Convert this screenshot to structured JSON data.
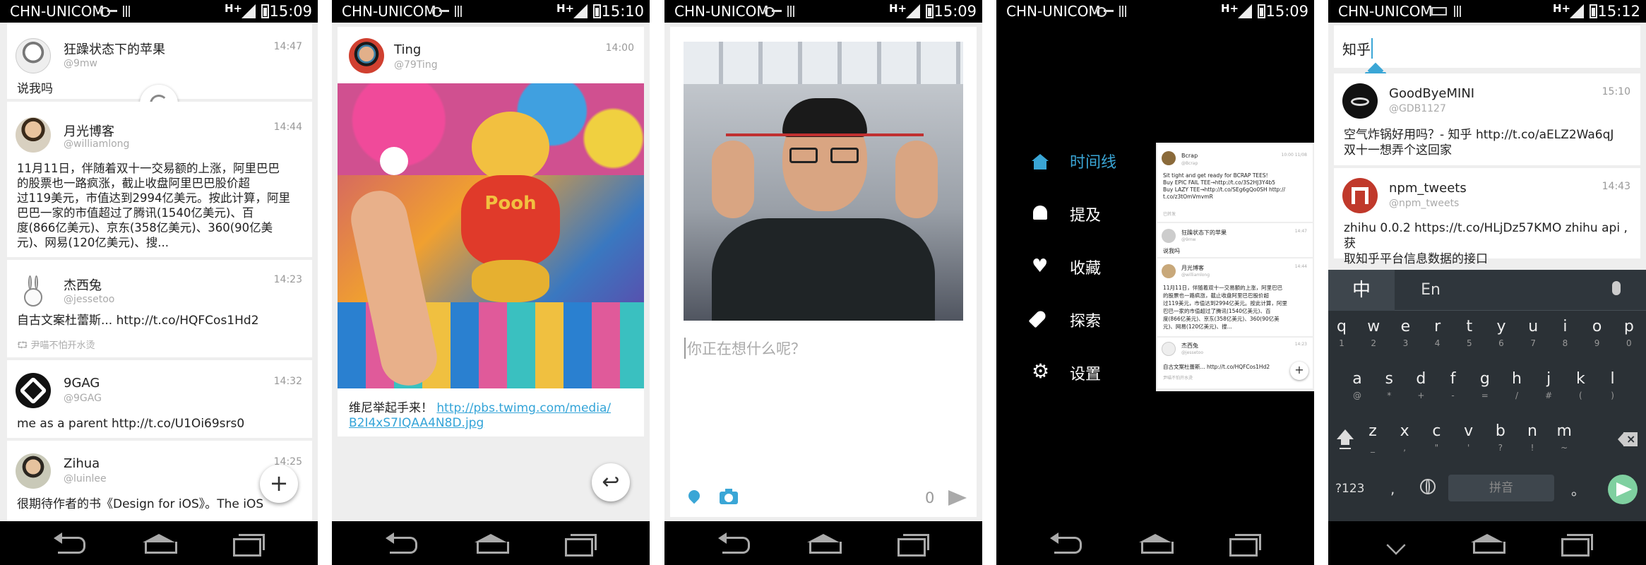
{
  "status": {
    "carrier": "CHN-UNICOM",
    "network": "H+",
    "times": [
      "15:09",
      "15:10",
      "15:09",
      "15:09",
      "15:12"
    ]
  },
  "timeline": {
    "tweets": [
      {
        "name": "狂躁状态下的苹果",
        "handle": "@9mw",
        "time": "14:47",
        "text": "说我吗"
      },
      {
        "name": "月光博客",
        "handle": "@williamlong",
        "time": "14:44",
        "lines": [
          "11月11日，伴随着双十一交易额的上涨，阿里巴巴",
          "的股票也一路疯涨，截止收盘阿里巴巴股价超",
          "过119美元，市值达到2994亿美元。按此计算，阿里",
          "巴巴一家的市值超过了腾讯(1540亿美元)、百",
          "度(866亿美元)、京东(358亿美元)、360(90亿美",
          "元)、网易(120亿美元)、搜..."
        ]
      },
      {
        "name": "杰西兔",
        "handle": "@jessetoo",
        "time": "14:23",
        "text": "自古文案杜蕾斯... http://t.co/HQFCos1Hd2",
        "retweet": "尹喵不怕开水烫"
      },
      {
        "name": "9GAG",
        "handle": "@9GAG",
        "time": "14:32",
        "text": "me as a parent http://t.co/U1Oi69srs0"
      },
      {
        "name": "Zihua",
        "handle": "@luinlee",
        "time": "14:25",
        "text": "很期待作者的书《Design for iOS》。The iOS"
      }
    ],
    "fab": "+"
  },
  "detail": {
    "name": "Ting",
    "handle": "@79Ting",
    "time": "14:00",
    "text": "维尼举起手来！",
    "link1": "http://pbs.twimg.com/media/",
    "link2": "B2I4xS7IQAA4N8D.jpg",
    "reply": "↩"
  },
  "compose": {
    "placeholder": "你正在想什么呢？",
    "count": "0"
  },
  "drawer": {
    "items": [
      {
        "label": "时间线",
        "icon": "home-icon",
        "active": true
      },
      {
        "label": "提及",
        "icon": "bell-icon"
      },
      {
        "label": "收藏",
        "icon": "heart-icon"
      },
      {
        "label": "探索",
        "icon": "rocket-icon"
      },
      {
        "label": "设置",
        "icon": "gear-icon"
      }
    ],
    "mini": {
      "t1name": "Bcrap",
      "t1handle": "@Bcrap",
      "t1time": "10:00 11/08",
      "t1lines": [
        "Sit tight and get ready for BCRAP TEES!",
        "Buy EPIC FAIL TEE→http://t.co/3S2HJ3Y4b5",
        "Buy LAZY TEE→http://t.co/SEg6gQo0SH http://",
        "t.co/z3tOmVmvmR"
      ],
      "t1rt": "已转发",
      "t2name": "狂躁状态下的苹果",
      "t2handle": "@9mw",
      "t2time": "14:47",
      "t2text": "说我吗",
      "t3name": "月光博客",
      "t3handle": "@williamlong",
      "t3time": "14:44",
      "t3lines": [
        "11月11日，伴随着双十一交易额的上涨，阿里巴巴",
        "的股票也一路疯涨，截止收盘阿里巴巴股价超",
        "过119美元，市值达到2994亿美元。按此计算，阿里",
        "巴巴一家的市值超过了腾讯(1540亿美元)、百",
        "度(866亿美元)、京东(358亿美元)、360(90亿美",
        "元)、网易(120亿美元)、搜..."
      ],
      "t4name": "杰西兔",
      "t4handle": "@jessetoo",
      "t4time": "14:23",
      "t4text": "自古文案杜蕾斯... http://t.co/HQFCos1Hd2",
      "t4rt": "尹喵不怕开水烫"
    }
  },
  "search": {
    "query": "知乎",
    "results": [
      {
        "name": "GoodByeMINI",
        "handle": "@GDB1127",
        "time": "15:10",
        "lines": [
          "空气炸锅好用吗？- 知乎 http://t.co/aELZ2Wa6qJ",
          "双十一想弄个这回家"
        ]
      },
      {
        "name": "npm_tweets",
        "handle": "@npm_tweets",
        "time": "14:43",
        "lines": [
          "zhihu 0.0.2 https://t.co/HLjDz57KMO zhihu api ,获",
          "取知乎平台信息数据的接口"
        ]
      }
    ]
  },
  "keyboard": {
    "lang_cn": "中",
    "lang_en": "En",
    "row1": [
      "q",
      "w",
      "e",
      "r",
      "t",
      "y",
      "u",
      "i",
      "o",
      "p"
    ],
    "row1sub": [
      "1",
      "2",
      "3",
      "4",
      "5",
      "6",
      "7",
      "8",
      "9",
      "0"
    ],
    "row2": [
      "a",
      "s",
      "d",
      "f",
      "g",
      "h",
      "j",
      "k",
      "l"
    ],
    "row2sub": [
      "@",
      "*",
      "+",
      "-",
      "=",
      "/",
      "#",
      "(",
      ")"
    ],
    "row3": [
      "z",
      "x",
      "c",
      "v",
      "b",
      "n",
      "m"
    ],
    "row3sub": [
      "_",
      ",",
      "\"",
      "'",
      "?",
      "!",
      "~"
    ],
    "sym": "?123",
    "comma": ",",
    "space": "拼音",
    "period": "。"
  }
}
